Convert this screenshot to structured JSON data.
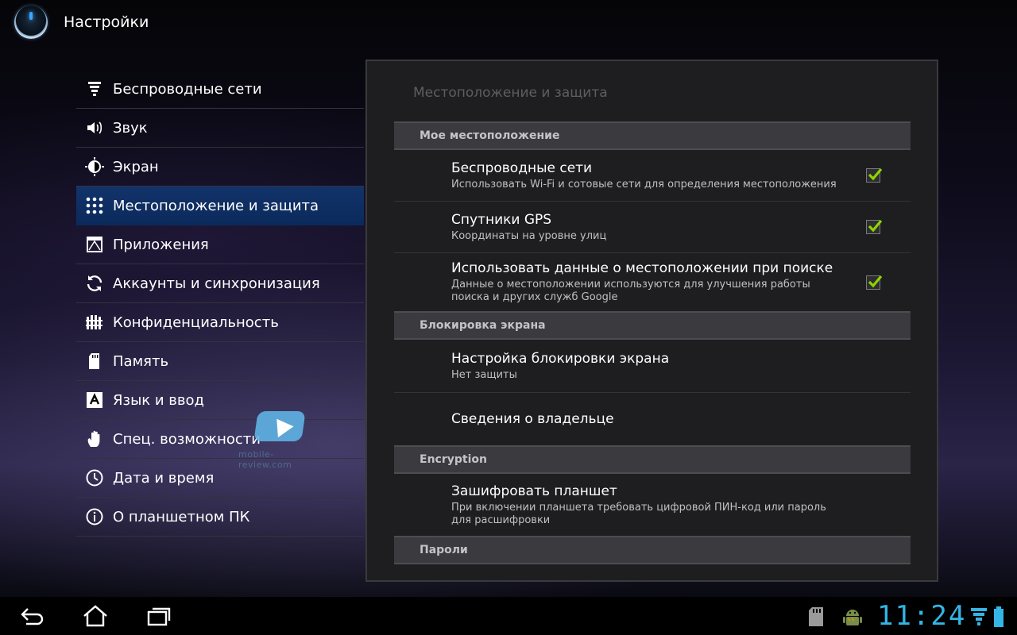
{
  "app": {
    "title": "Настройки"
  },
  "menu": {
    "items": [
      {
        "label": "Беспроводные сети",
        "icon": "wireless-icon"
      },
      {
        "label": "Звук",
        "icon": "speaker-icon"
      },
      {
        "label": "Экран",
        "icon": "brightness-icon"
      },
      {
        "label": "Местоположение и защита",
        "icon": "location-grid-icon",
        "selected": true
      },
      {
        "label": "Приложения",
        "icon": "apps-icon"
      },
      {
        "label": "Аккаунты и синхронизация",
        "icon": "sync-icon"
      },
      {
        "label": "Конфиденциальность",
        "icon": "privacy-fence-icon"
      },
      {
        "label": "Память",
        "icon": "sd-card-icon"
      },
      {
        "label": "Язык и ввод",
        "icon": "keyboard-a-icon"
      },
      {
        "label": "Спец. возможности",
        "icon": "hand-icon"
      },
      {
        "label": "Дата и время",
        "icon": "clock-icon"
      },
      {
        "label": "О планшетном ПК",
        "icon": "info-icon"
      }
    ]
  },
  "watermark": {
    "text": "mobile-review.com"
  },
  "panel": {
    "title": "Местоположение и защита",
    "sections": [
      {
        "header": "Мое местоположение",
        "prefs": [
          {
            "title": "Беспроводные сети",
            "summary": "Использовать Wi-Fi и сотовые сети для определения местоположения",
            "checked": true
          },
          {
            "title": "Спутники GPS",
            "summary": "Координаты на уровне улиц",
            "checked": true
          },
          {
            "title": "Использовать данные о местоположении при поиске",
            "summary": "Данные о местоположении используются для улучшения работы поиска и других служб Google",
            "checked": true
          }
        ]
      },
      {
        "header": "Блокировка экрана",
        "prefs": [
          {
            "title": "Настройка блокировки экрана",
            "summary": "Нет защиты"
          },
          {
            "title": "Сведения о владельце"
          }
        ]
      },
      {
        "header": "Encryption",
        "prefs": [
          {
            "title": "Зашифровать планшет",
            "summary": "При включении планшета требовать цифровой ПИН-код или пароль для расшифровки"
          }
        ]
      },
      {
        "header": "Пароли",
        "prefs": []
      }
    ]
  },
  "statusbar": {
    "time": "11:24",
    "icons": [
      "sd-card-icon",
      "android-debug-icon",
      "wifi-icon",
      "battery-icon"
    ],
    "accent": "#33b5e5"
  },
  "colors": {
    "selected": "#0b2a5c",
    "check": "#8dd400",
    "section": "#3b3b3f"
  }
}
